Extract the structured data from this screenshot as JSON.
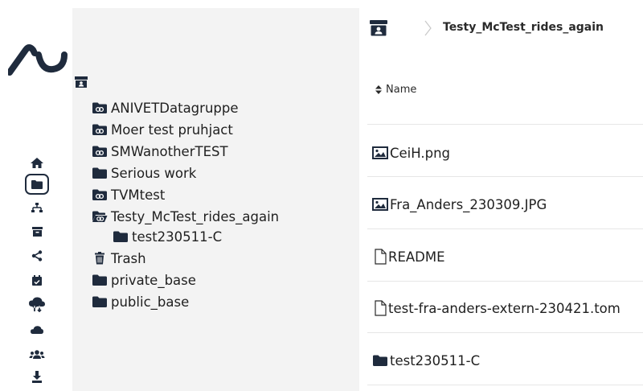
{
  "nav_icons": [
    "home-icon",
    "folder-icon",
    "sitemap-icon",
    "archive-icon",
    "share-icon",
    "calendar-check-icon",
    "cloud-transfer-icon",
    "cloud-icon",
    "users-icon",
    "download-icon"
  ],
  "tree": {
    "items": [
      {
        "label": "ANIVETDatagruppe",
        "icon": "shared-folder-icon"
      },
      {
        "label": "Moer test pruhjact",
        "icon": "shared-folder-icon"
      },
      {
        "label": "SMWanotherTEST",
        "icon": "shared-folder-icon"
      },
      {
        "label": "Serious work",
        "icon": "folder-icon"
      },
      {
        "label": "TVMtest",
        "icon": "shared-folder-icon"
      },
      {
        "label": "Testy_McTest_rides_again",
        "icon": "shared-folder-open-icon"
      },
      {
        "label": "test230511-C",
        "icon": "folder-icon"
      },
      {
        "label": "Trash",
        "icon": "trash-icon"
      },
      {
        "label": "private_base",
        "icon": "folder-icon"
      },
      {
        "label": "public_base",
        "icon": "folder-icon"
      }
    ]
  },
  "breadcrumb": {
    "title": "Testy_McTest_rides_again"
  },
  "table": {
    "header": "Name",
    "rows": [
      {
        "name": "CeiH.png",
        "icon": "image-icon"
      },
      {
        "name": "Fra_Anders_230309.JPG",
        "icon": "image-icon"
      },
      {
        "name": "README",
        "icon": "file-icon"
      },
      {
        "name": "test-fra-anders-extern-230421.tom",
        "icon": "file-icon"
      },
      {
        "name": "test230511-C",
        "icon": "folder-icon"
      }
    ]
  },
  "colors": {
    "navy": "#1f2b3d",
    "tree_bg": "#f3f3f3",
    "divider": "#e6e6e6"
  }
}
